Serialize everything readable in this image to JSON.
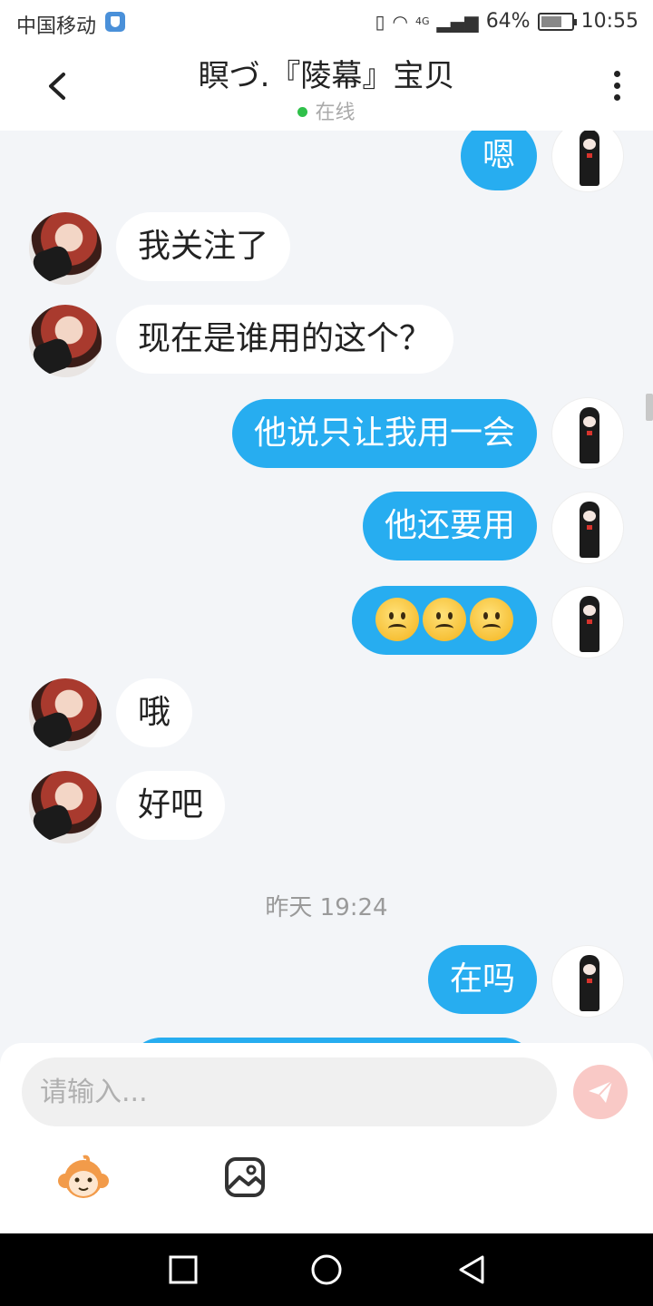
{
  "status_bar": {
    "carrier": "中国移动",
    "network": "4G",
    "battery": "64%",
    "battery_level": 0.64,
    "time": "10:55"
  },
  "header": {
    "title": "瞑づ.『陵幕』宝贝",
    "status": "在线"
  },
  "messages": [
    {
      "side": "out",
      "text": "嗯"
    },
    {
      "side": "in",
      "text": "我关注了"
    },
    {
      "side": "in",
      "text": "现在是谁用的这个？"
    },
    {
      "side": "out",
      "text": "他说只让我用一会"
    },
    {
      "side": "out",
      "text": "他还要用"
    },
    {
      "side": "out",
      "emoji_count": 3,
      "emoji": "frowning-face"
    },
    {
      "side": "in",
      "text": "哦"
    },
    {
      "side": "in",
      "text": "好吧"
    },
    {
      "side": "out",
      "text": "在吗"
    }
  ],
  "timestamp": "昨天 19:24",
  "composer": {
    "placeholder": "请输入..."
  },
  "icons": {
    "send": "paper-plane-icon",
    "sticker": "monkey-sticker-icon",
    "image": "image-icon"
  },
  "colors": {
    "outgoing_bubble": "#27adf0",
    "incoming_bubble": "#ffffff",
    "online_dot": "#2fc04a",
    "send_button": "#f9c9c6"
  }
}
